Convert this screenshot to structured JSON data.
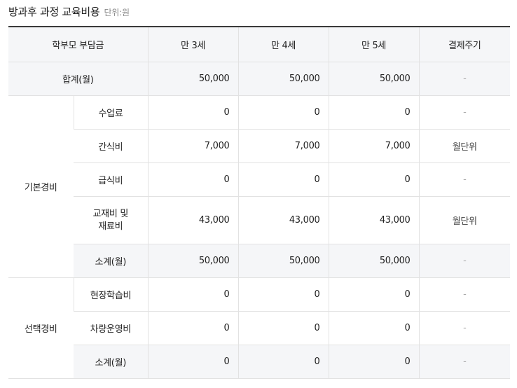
{
  "title": "방과후 과정 교육비용",
  "unit": "단위:원",
  "header": {
    "payer": "학부모 부담금",
    "age3": "만 3세",
    "age4": "만 4세",
    "age5": "만 5세",
    "cycle": "결제주기"
  },
  "total": {
    "label": "합계(월)",
    "age3": "50,000",
    "age4": "50,000",
    "age5": "50,000",
    "cycle": "-"
  },
  "basic": {
    "group": "기본경비",
    "rows": [
      {
        "label": "수업료",
        "age3": "0",
        "age4": "0",
        "age5": "0",
        "cycle": "-"
      },
      {
        "label": "간식비",
        "age3": "7,000",
        "age4": "7,000",
        "age5": "7,000",
        "cycle": "월단위"
      },
      {
        "label": "급식비",
        "age3": "0",
        "age4": "0",
        "age5": "0",
        "cycle": "-"
      },
      {
        "label": "교재비 및\n재료비",
        "age3": "43,000",
        "age4": "43,000",
        "age5": "43,000",
        "cycle": "월단위"
      }
    ],
    "subtotal": {
      "label": "소계(월)",
      "age3": "50,000",
      "age4": "50,000",
      "age5": "50,000",
      "cycle": "-"
    }
  },
  "optional": {
    "group": "선택경비",
    "rows": [
      {
        "label": "현장학습비",
        "age3": "0",
        "age4": "0",
        "age5": "0",
        "cycle": "-"
      },
      {
        "label": "차량운영비",
        "age3": "0",
        "age4": "0",
        "age5": "0",
        "cycle": "-"
      }
    ],
    "subtotal": {
      "label": "소계(월)",
      "age3": "0",
      "age4": "0",
      "age5": "0",
      "cycle": "-"
    }
  }
}
